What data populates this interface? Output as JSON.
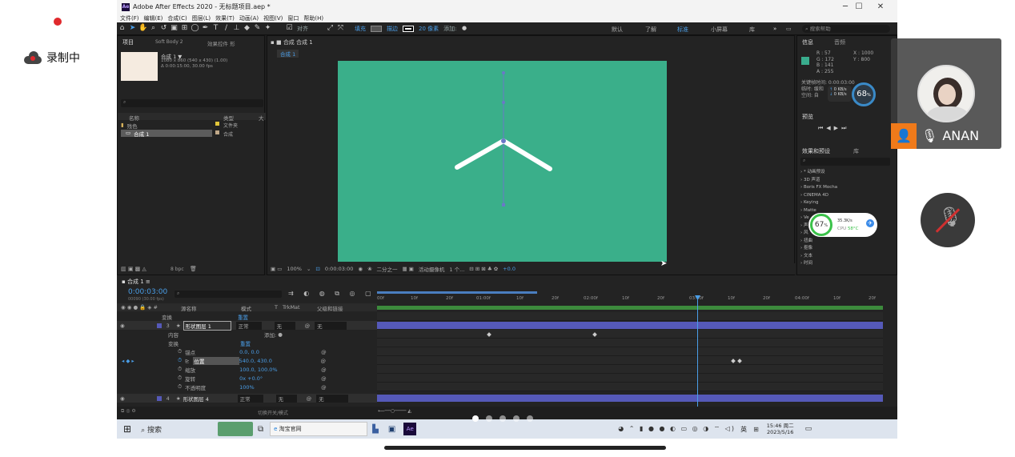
{
  "recording": {
    "label": "录制中"
  },
  "window": {
    "title": "Adobe After Effects 2020 - 无标题项目.aep *",
    "min": "─",
    "max": "☐",
    "close": "✕"
  },
  "menu": [
    "文件(F)",
    "编辑(E)",
    "合成(C)",
    "图层(L)",
    "效果(T)",
    "动画(A)",
    "视图(V)",
    "窗口",
    "帮助(H)"
  ],
  "toolbar": {
    "align": "对齐",
    "fill": "填充",
    "stroke": "描边",
    "stroke_size": "20 像素",
    "add": "添加:",
    "workspaces": [
      "默认",
      "了解",
      "标准",
      "小屏幕",
      "库"
    ],
    "search_placeholder": "搜索帮助"
  },
  "project": {
    "tab": "项目",
    "tab2": "Soft Body 2",
    "tab3": "效果控件 形",
    "comp_name": "合成 1 ▼",
    "comp_size": "1080 x 860 (540 x 430) (1.00)",
    "comp_duration": "Δ 0:00:15:00, 30.00 fps",
    "col_name": "名称",
    "col_type": "类型",
    "col_size": "大",
    "items": [
      {
        "name": "残色",
        "type": "文件夹"
      },
      {
        "name": "合成 1",
        "type": "合成"
      }
    ],
    "bpc": "8 bpc"
  },
  "viewer": {
    "tab": "合成 合成 1",
    "breadcrumb": "合成 1",
    "zoom": "100%",
    "time": "0:00:03:00",
    "res": "二分之一",
    "camera": "活动摄像机",
    "views": "1 个...",
    "offset": "+0.0",
    "canvas_color": "#3aaf8a"
  },
  "info": {
    "tab": "信息",
    "tab2": "音频",
    "r": "R : 57",
    "g": "G : 172",
    "b": "B : 141",
    "a": "A : 255",
    "x": "X : 1000",
    "y": "Y : 800",
    "swatch": "#39ac8d",
    "keyframe": "关键帧时间: 0:00:03:00",
    "temporal": "临时: 缓和",
    "spatial": "空间: 自",
    "speed1": "0 KB/s",
    "speed2": "0 KB/s",
    "pct": "68",
    "pct_unit": "%",
    "preview_tab": "预览",
    "effects_tab": "效果和预设",
    "library_tab": "库",
    "effects": [
      "* 动画预设",
      "3D 声道",
      "Boris FX Mocha",
      "CINEMA 4D",
      "Keying",
      "Matte",
      "Ve",
      "声",
      "风",
      "扭曲",
      "抠像",
      "文本",
      "时间"
    ],
    "cpu_pct": "67",
    "cpu_unit": "%",
    "cpu_speed": "35.3K/s",
    "cpu_label": "CPU",
    "cpu_temp": "58°C"
  },
  "timeline": {
    "tab": "合成 1",
    "time": "0:00:03:00",
    "frames": "00090 (30.00 fps)",
    "col_layer": "源名称",
    "col_mode": "模式",
    "col_t": "T",
    "col_trk": "TrkMat",
    "col_parent": "父级和链接",
    "ticks": [
      "00f",
      "10f",
      "20f",
      "01:00f",
      "10f",
      "20f",
      "02:00f",
      "10f",
      "20f",
      "03:00f",
      "10f",
      "20f",
      "04:00f",
      "10f",
      "20f"
    ],
    "rows": [
      {
        "name": "变换",
        "value": "重置"
      },
      {
        "idx": "3",
        "name": "形状图层 1",
        "mode": "正常",
        "trk": "无",
        "parent": "无"
      },
      {
        "name": "内容",
        "value": "添加:"
      },
      {
        "name": "变换",
        "value": "重置"
      },
      {
        "name": "锚点",
        "value": "0.0, 0.0"
      },
      {
        "name": "位置",
        "value": "540.0, 430.0"
      },
      {
        "name": "缩放",
        "value": "100.0, 100.0%"
      },
      {
        "name": "旋转",
        "value": "0x +0.0°"
      },
      {
        "name": "不透明度",
        "value": "100%"
      },
      {
        "idx": "4",
        "name": "形状图层 4",
        "mode": "正常",
        "trk": "无",
        "parent": "无"
      }
    ],
    "footer": "切换开关/模式"
  },
  "taskbar": {
    "search": "搜索",
    "browser": "淘宝官网",
    "ime": "英",
    "time": "15:46 周二",
    "date": "2023/5/16"
  },
  "overlay": {
    "user": "ANAN"
  }
}
